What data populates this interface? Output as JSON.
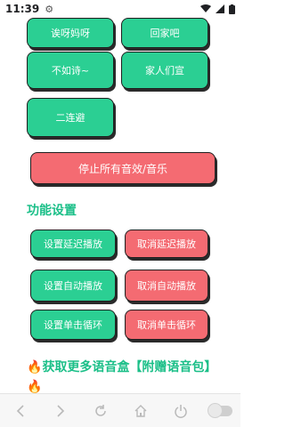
{
  "status_bar": {
    "time": "11:39",
    "settings_icon": "gear-icon"
  },
  "sound_buttons": [
    "诶呀妈呀",
    "回家吧",
    "不如诗~",
    "家人们宣",
    "二连避"
  ],
  "stop_all_label": "停止所有音效/音乐",
  "section_title": "功能设置",
  "settings": {
    "set_delay": "设置延迟播放",
    "cancel_delay": "取消延迟播放",
    "set_auto": "设置自动播放",
    "cancel_auto": "取消自动播放",
    "set_loop": "设置单击循环",
    "cancel_loop": "取消单击循环"
  },
  "promo_text": "获取更多语音盒【附赠语音包】",
  "colors": {
    "green": "#2bcf93",
    "red": "#f46b72",
    "title": "#1bbf88"
  }
}
